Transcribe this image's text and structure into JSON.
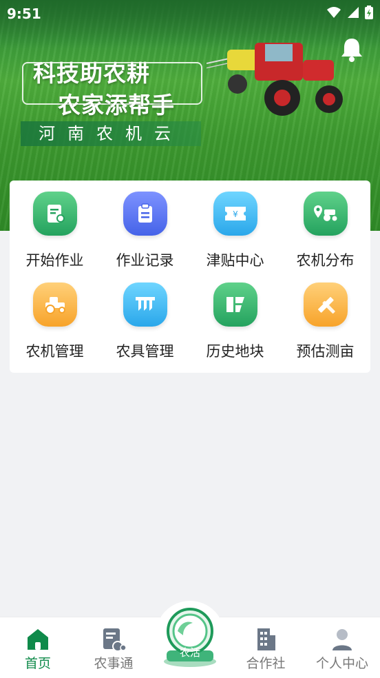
{
  "status_bar": {
    "time": "9:51"
  },
  "banner": {
    "slogan_line1": "科技助农耕",
    "slogan_line2": "农家添帮手",
    "slogan_sub": "河南农机云"
  },
  "menu": [
    {
      "label": "开始作业",
      "icon": "start-work-icon",
      "color_from": "#5fd18a",
      "color_to": "#24a25e"
    },
    {
      "label": "作业记录",
      "icon": "clipboard-icon",
      "color_from": "#7d92ff",
      "color_to": "#4563e8"
    },
    {
      "label": "津贴中心",
      "icon": "coupon-icon",
      "color_from": "#6fd5ff",
      "color_to": "#2aa7ea"
    },
    {
      "label": "农机分布",
      "icon": "tractor-location-icon",
      "color_from": "#5fd18a",
      "color_to": "#24a25e"
    },
    {
      "label": "农机管理",
      "icon": "tractor-icon",
      "color_from": "#ffd079",
      "color_to": "#f7a32a"
    },
    {
      "label": "农具管理",
      "icon": "harrow-icon",
      "color_from": "#6fd5ff",
      "color_to": "#2aa7ea"
    },
    {
      "label": "历史地块",
      "icon": "field-blocks-icon",
      "color_from": "#5fd18a",
      "color_to": "#24a25e"
    },
    {
      "label": "预估测亩",
      "icon": "ruler-pencil-icon",
      "color_from": "#ffd079",
      "color_to": "#f7a32a"
    }
  ],
  "nav": {
    "home": "首页",
    "farm_news": "农事通",
    "center": "农活",
    "coop": "合作社",
    "profile": "个人中心"
  },
  "colors": {
    "accent": "#0f8a4a"
  }
}
